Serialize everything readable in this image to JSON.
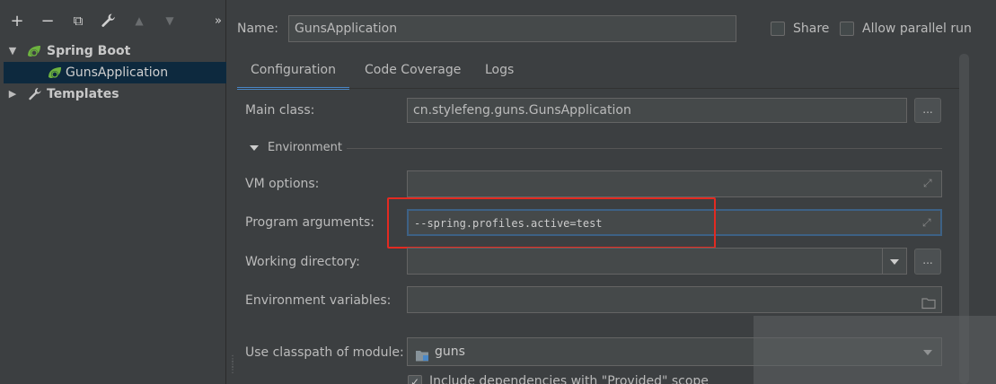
{
  "toolbar": {
    "add": "+",
    "remove": "−",
    "copy": "⧉",
    "edit": "🔧",
    "up": "▲",
    "down": "▼",
    "more": "»"
  },
  "tree": {
    "spring_boot": "Spring Boot",
    "guns_app": "GunsApplication",
    "templates": "Templates"
  },
  "header": {
    "name_label": "Name:",
    "name_value": "GunsApplication",
    "share_label": "Share",
    "allow_parallel_label": "Allow parallel run"
  },
  "tabs": [
    "Configuration",
    "Code Coverage",
    "Logs"
  ],
  "form": {
    "main_class_label": "Main class:",
    "main_class_value": "cn.stylefeng.guns.GunsApplication",
    "browse": "...",
    "environment_label": "Environment",
    "vm_options_label": "VM options:",
    "vm_options_value": "",
    "program_args_label": "Program arguments:",
    "program_args_value": "--spring.profiles.active=test",
    "working_dir_label": "Working directory:",
    "working_dir_value": "",
    "env_vars_label": "Environment variables:",
    "env_vars_value": "",
    "classpath_label": "Use classpath of module:",
    "classpath_value": "guns",
    "include_deps_label": "Include dependencies with \"Provided\" scope"
  },
  "colors": {
    "background": "#3c3f41",
    "field": "#45494a",
    "selection": "#0d293e",
    "accent": "#4a88c7",
    "highlight": "#e32a21",
    "spring_green": "#6db33f"
  }
}
